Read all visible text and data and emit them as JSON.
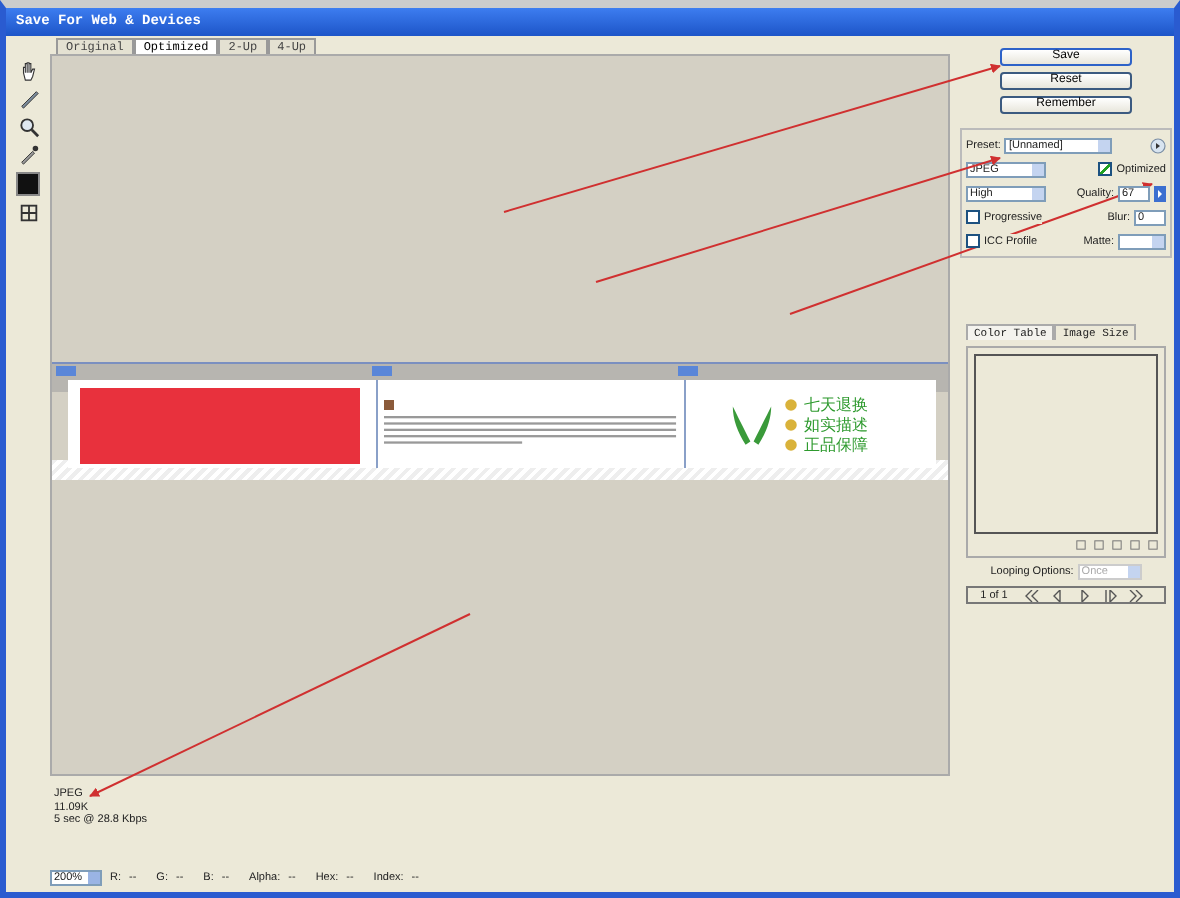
{
  "window": {
    "title": "Save For Web & Devices"
  },
  "tabs": [
    {
      "label": "Original",
      "selected": false
    },
    {
      "label": "Optimized",
      "selected": true
    },
    {
      "label": "2-Up",
      "selected": false
    },
    {
      "label": "4-Up",
      "selected": false
    }
  ],
  "preview": {
    "features": [
      "七天退换",
      "如实描述",
      "正品保障"
    ]
  },
  "info": [
    "JPEG",
    "11.09K",
    "5 sec @ 28.8 Kbps"
  ],
  "buttons": [
    "Save",
    "Reset",
    "Remember"
  ],
  "preset": {
    "label": "Preset:",
    "value": "[Unnamed]"
  },
  "format": "JPEG",
  "quality_level": "High",
  "optimized": {
    "label": "Optimized",
    "checked": true
  },
  "quality": {
    "label": "Quality:",
    "value": "67"
  },
  "progressive": {
    "label": "Progressive",
    "checked": false
  },
  "blur": {
    "label": "Blur:",
    "value": "0"
  },
  "icc_profile": {
    "label": "ICC Profile",
    "checked": false
  },
  "matte": {
    "label": "Matte:"
  },
  "panel_tabs": [
    {
      "label": "Color Table",
      "selected": true
    },
    {
      "label": "Image Size",
      "selected": false
    }
  ],
  "looping": {
    "label": "Looping Options:",
    "value": "Once",
    "disabled": true
  },
  "frames": "1 of 1",
  "status": {
    "zoom": "200%",
    "readouts": [
      {
        "label": "R:",
        "value": "--"
      },
      {
        "label": "G:",
        "value": "--"
      },
      {
        "label": "B:",
        "value": "--"
      },
      {
        "label": "Alpha:",
        "value": "--"
      },
      {
        "label": "Hex:",
        "value": "--"
      },
      {
        "label": "Index:",
        "value": "--"
      }
    ]
  }
}
